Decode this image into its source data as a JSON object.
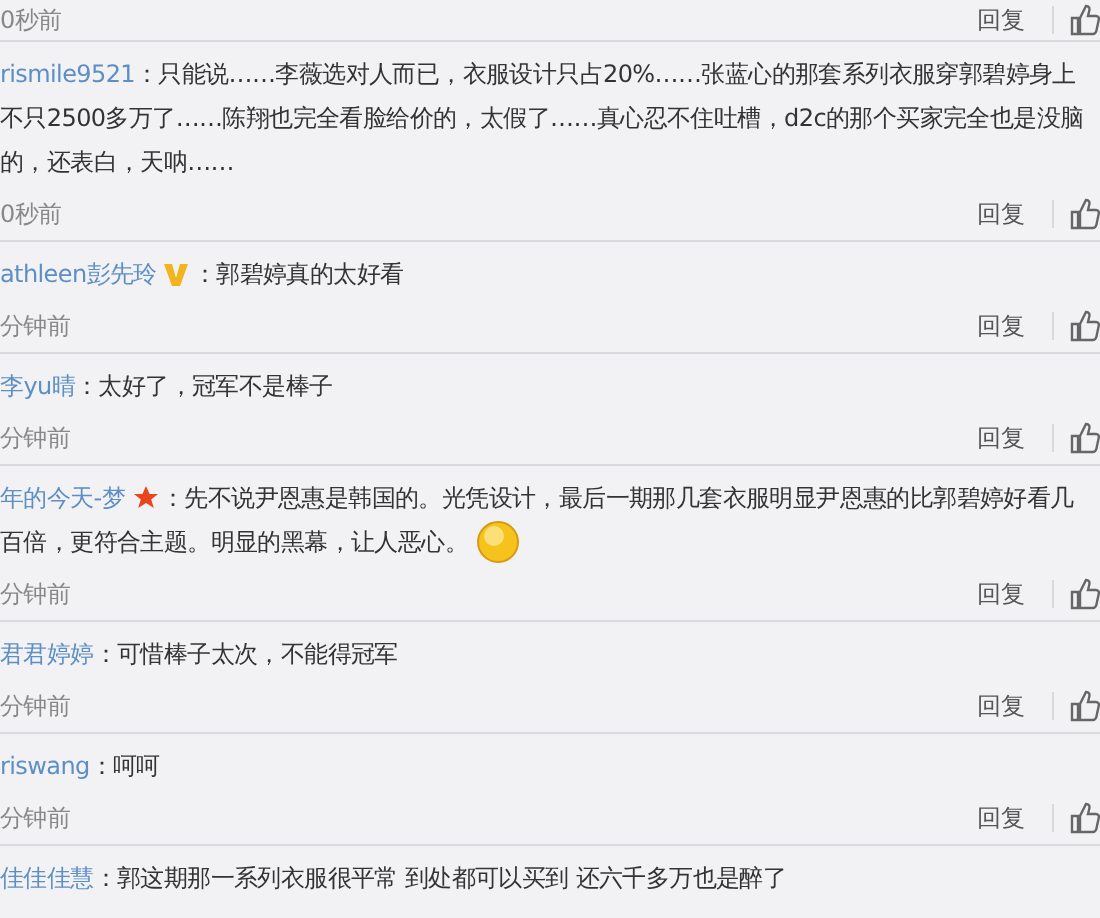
{
  "top_meta": {
    "time": "0秒前",
    "reply": "回复"
  },
  "comments": [
    {
      "user": "rismile9521",
      "kind": "plain",
      "lines": [
        "：只能说……李薇选对人而已，衣服设计只占20%……张蓝心的那套系列衣服穿郭碧婷身上",
        "不只2500多万了……陈翔也完全看脸给价的，太假了……真心忍不住吐槽，d2c的那个买家完全也是没脑",
        "的，还表白，天呐……"
      ],
      "time": "0秒前",
      "reply": "回复"
    },
    {
      "user": "athleen彭先玲",
      "kind": "vip",
      "lines": [
        "：郭碧婷真的太好看"
      ],
      "time": "分钟前",
      "reply": "回复"
    },
    {
      "user": "李yu晴",
      "kind": "plain",
      "lines": [
        "：太好了，冠军不是棒子"
      ],
      "time": "分钟前",
      "reply": "回复"
    },
    {
      "user": "年的今天-梦",
      "kind": "star",
      "lines": [
        "：先不说尹恩惠是韩国的。光凭设计，最后一期那几套衣服明显尹恩惠的比郭碧婷好看几",
        "百倍，更符合主题。明显的黑幕，让人恶心。"
      ],
      "emoji": true,
      "time": "分钟前",
      "reply": "回复"
    },
    {
      "user": "君君婷婷",
      "kind": "plain",
      "lines": [
        "：可惜棒子太次，不能得冠军"
      ],
      "time": "分钟前",
      "reply": "回复"
    },
    {
      "user": "riswang",
      "kind": "plain",
      "lines": [
        "：呵呵"
      ],
      "time": "分钟前",
      "reply": "回复"
    },
    {
      "user": "佳佳佳慧",
      "kind": "plain",
      "lines": [
        "：郭这期那一系列衣服很平常 到处都可以买到 还六千多万也是醉了"
      ]
    }
  ]
}
